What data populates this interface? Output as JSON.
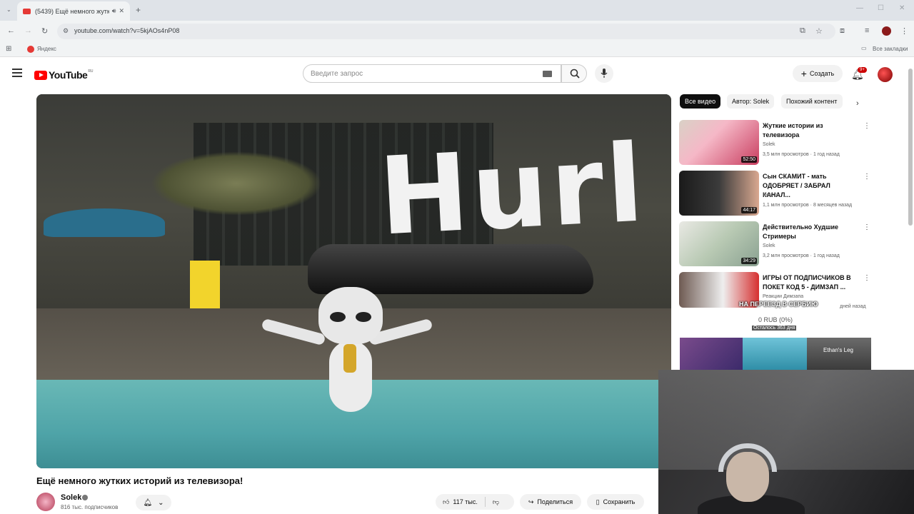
{
  "browser": {
    "tab_title": "(5439) Ещё немного жутк",
    "url": "youtube.com/watch?v=5kjAOs4nP08",
    "bookmark_yandex": "Яндекс",
    "bookmark_all": "Все закладки"
  },
  "header": {
    "logo_text": "YouTube",
    "logo_region": "RU",
    "search_placeholder": "Введите запрос",
    "create_label": "Создать",
    "notifications_badge": "9+"
  },
  "player": {
    "overlay_text": "Hurl"
  },
  "video": {
    "title": "Ещё немного жутких историй из телевизора!",
    "channel": "Solek",
    "subscribers": "816 тыс. подписчиков",
    "likes": "117 тыс.",
    "share_label": "Поделиться",
    "save_label": "Сохранить"
  },
  "chips": [
    {
      "label": "Все видео"
    },
    {
      "label": "Автор: Solek"
    },
    {
      "label": "Похожий контент"
    }
  ],
  "recommendations": [
    {
      "title": "Жуткие истории из телевизора",
      "channel": "Solek",
      "meta": "3,5 млн просмотров · 1 год назад",
      "duration": "52:50"
    },
    {
      "title": "Сын СКАМИТ - мать ОДОБРЯЕТ / ЗАБРАЛ КАНАЛ...",
      "channel": "Rennix",
      "meta": "1,1 млн просмотров · 8 месяцев назад",
      "duration": "44:17"
    },
    {
      "title": "Действительно Худшие Стримеры",
      "channel": "Solek",
      "meta": "3,2 млн просмотров · 1 год назад",
      "duration": "34:29"
    },
    {
      "title": "ИГРЫ ОТ ПОДПИСЧИКОВ В ПОКЕТ КОД 5 - ДИМЗАП ...",
      "channel": "Реакции Димзапа",
      "meta": "дней назад",
      "duration": ""
    }
  ],
  "donation": {
    "title": "НА ПЕРЕЕЗД В СЕРБИЮ",
    "amount": "0 RUB (0%)",
    "remaining": "Осталось 363 дня",
    "progress_percent": 0
  },
  "strip": {
    "label": "Ethan's Leg"
  },
  "colors": {
    "brand_red": "#ff0000",
    "active_chip": "#0f0f0f"
  }
}
